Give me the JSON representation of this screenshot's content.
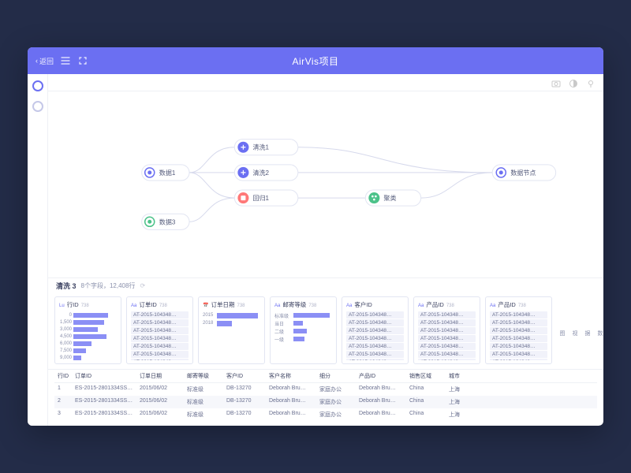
{
  "titlebar": {
    "back": "返回",
    "title": "AirVis项目"
  },
  "sidebar": {
    "items": [
      "node-icon",
      "node-icon-dim"
    ]
  },
  "canvas_nodes": {
    "data1": "数据1",
    "data3": "数据3",
    "clean1": "清洗1",
    "clean2": "清洗2",
    "regress1": "回归1",
    "cluster": "聚类",
    "endpoint": "数据节点"
  },
  "mid_header": {
    "title": "清洗 3",
    "meta": "8个字段，12,408行"
  },
  "side_tabs": [
    "数",
    "据",
    "视",
    "图"
  ],
  "cards": [
    {
      "type": "hist",
      "icon": "Lu",
      "title": "行ID",
      "count": "738",
      "data": [
        {
          "label": "0",
          "v": 0.85
        },
        {
          "label": "1,500",
          "v": 0.75
        },
        {
          "label": "3,000",
          "v": 0.6
        },
        {
          "label": "4,500",
          "v": 0.8
        },
        {
          "label": "6,000",
          "v": 0.45
        },
        {
          "label": "7,500",
          "v": 0.3
        },
        {
          "label": "9,000",
          "v": 0.2
        }
      ]
    },
    {
      "type": "list",
      "icon": "Aa",
      "title": "订单ID",
      "count": "738",
      "data": [
        "AT-2015-104348…",
        "AT-2015-104348…",
        "AT-2015-104348…",
        "AT-2015-104348…",
        "AT-2015-104348…",
        "AT-2015-104348…",
        "AT-2015-104348…"
      ]
    },
    {
      "type": "year",
      "icon": "📅",
      "title": "订单日期",
      "count": "738",
      "data": [
        {
          "label": "2015",
          "v": 0.95
        },
        {
          "label": "2018",
          "v": 0.35
        }
      ]
    },
    {
      "type": "cat",
      "icon": "Aa",
      "title": "邮寄等级",
      "count": "738",
      "data": [
        {
          "label": "标准级",
          "v": 0.95
        },
        {
          "label": "当日",
          "v": 0.25
        },
        {
          "label": "二级",
          "v": 0.35
        },
        {
          "label": "一级",
          "v": 0.3
        }
      ]
    },
    {
      "type": "list",
      "icon": "Aa",
      "title": "客户ID",
      "count": "",
      "data": [
        "AT-2015-104348…",
        "AT-2015-104348…",
        "AT-2015-104348…",
        "AT-2015-104348…",
        "AT-2015-104348…",
        "AT-2015-104348…",
        "AT-2015-104348…"
      ]
    },
    {
      "type": "list",
      "icon": "Aa",
      "title": "产品ID",
      "count": "738",
      "data": [
        "AT-2015-104348…",
        "AT-2015-104348…",
        "AT-2015-104348…",
        "AT-2015-104348…",
        "AT-2015-104348…",
        "AT-2015-104348…",
        "AT-2015-104348…"
      ]
    },
    {
      "type": "list",
      "icon": "Aa",
      "title": "产品ID",
      "count": "738",
      "data": [
        "AT-2015-104348…",
        "AT-2015-104348…",
        "AT-2015-104348…",
        "AT-2015-104348…",
        "AT-2015-104348…",
        "AT-2015-104348…",
        "AT-2015-104348…"
      ]
    }
  ],
  "table": {
    "headers": [
      "行ID",
      "订单ID",
      "订单日期",
      "邮寄等级",
      "客户ID",
      "客户名称",
      "细分",
      "产品ID",
      "销售区域",
      "城市"
    ],
    "rows": [
      [
        "1",
        "ES-2015-2801334SS…",
        "2015/06/02",
        "标准级",
        "DB-13270",
        "Deborah Bru…",
        "家庭办公",
        "Deborah Bru…",
        "China",
        "上海"
      ],
      [
        "2",
        "ES-2015-2801334SS…",
        "2015/06/02",
        "标准级",
        "DB-13270",
        "Deborah Bru…",
        "家庭办公",
        "Deborah Bru…",
        "China",
        "上海"
      ],
      [
        "3",
        "ES-2015-2801334SS…",
        "2015/06/02",
        "标准级",
        "DB-13270",
        "Deborah Bru…",
        "家庭办公",
        "Deborah Bru…",
        "China",
        "上海"
      ]
    ]
  }
}
